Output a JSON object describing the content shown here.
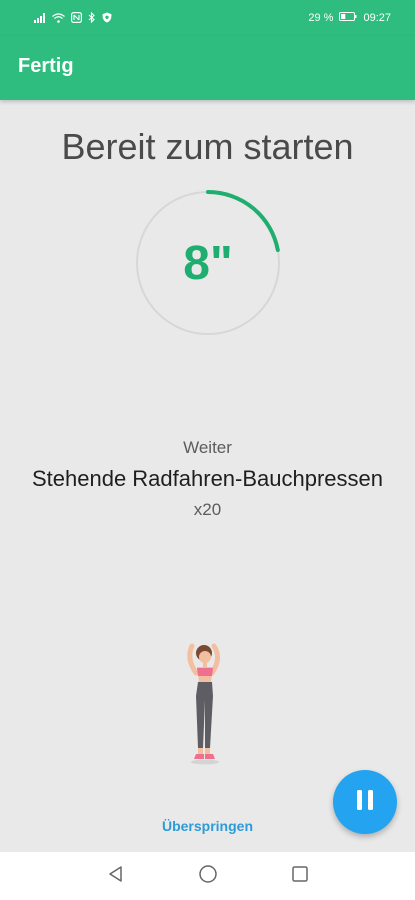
{
  "status_bar": {
    "battery": "29 %",
    "time": "09:27",
    "icons": [
      "signal-icon",
      "wifi-icon",
      "nfc-icon",
      "bluetooth-icon",
      "shield-icon",
      "battery-icon"
    ]
  },
  "app_bar": {
    "done_label": "Fertig",
    "color": "#2ebd7f"
  },
  "main": {
    "heading": "Bereit zum starten",
    "countdown": "8\"",
    "countdown_color": "#1fae6f",
    "next_label": "Weiter",
    "exercise_name": "Stehende Radfahren-Bauchpressen",
    "reps": "x20",
    "skip_label": "Überspringen",
    "skip_color": "#2c9bd9"
  },
  "fab": {
    "icon": "pause-icon",
    "color": "#23a3f0"
  },
  "nav_bar": {
    "icons": [
      "back-icon",
      "home-icon",
      "recents-icon"
    ]
  }
}
